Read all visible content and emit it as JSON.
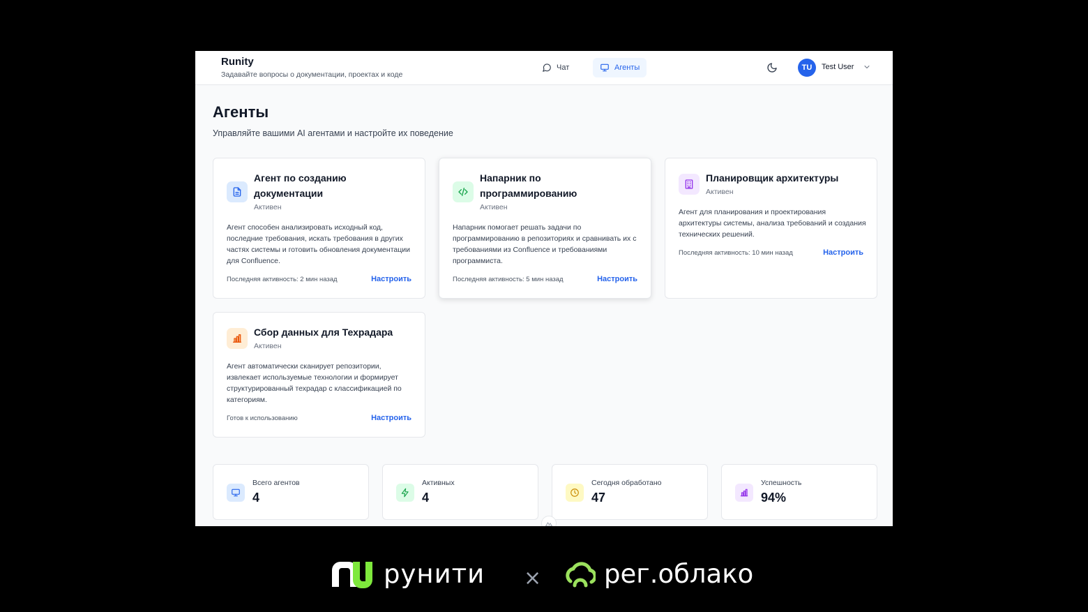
{
  "header": {
    "brand_title": "Runity",
    "brand_subtitle": "Задавайте вопросы о документации, проектах и коде",
    "nav": {
      "chat_label": "Чат",
      "agents_label": "Агенты",
      "active": "agents"
    },
    "user": {
      "initials": "TU",
      "name": "Test User",
      "avatar_color": "#2563eb"
    }
  },
  "page": {
    "title": "Агенты",
    "subtitle": "Управляйте вашими AI агентами и настройте их поведение"
  },
  "agents": [
    {
      "icon": "document-icon",
      "icon_color": "#2563eb",
      "icon_bg": "#dbeafe",
      "title": "Агент по созданию документации",
      "status": "Активен",
      "description": "Агент способен анализировать исходный код, последние требования, искать требования в других частях системы и готовить обновления документации для Confluence.",
      "meta": "Последняя активность: 2 мин назад",
      "action": "Настроить"
    },
    {
      "icon": "code-icon",
      "icon_color": "#16a34a",
      "icon_bg": "#dcfce7",
      "title": "Напарник по программированию",
      "status": "Активен",
      "description": "Напарник помогает решать задачи по программированию в репозиториях и сравнивать их с требованиями из Confluence и требованиями программиста.",
      "meta": "Последняя активность: 5 мин назад",
      "action": "Настроить"
    },
    {
      "icon": "building-icon",
      "icon_color": "#9333ea",
      "icon_bg": "#f3e8ff",
      "title": "Планировщик архитектуры",
      "status": "Активен",
      "description": "Агент для планирования и проектирования архитектуры системы, анализа требований и создания технических решений.",
      "meta": "Последняя активность: 10 мин назад",
      "action": "Настроить"
    },
    {
      "icon": "bar-chart-icon",
      "icon_color": "#ea580c",
      "icon_bg": "#ffedd5",
      "title": "Сбор данных для Техрадара",
      "status": "Активен",
      "description": "Агент автоматически сканирует репозитории, извлекает используемые технологии и формирует структурированный техрадар с классификацией по категориям.",
      "meta": "Готов к использованию",
      "action": "Настроить"
    }
  ],
  "stats": [
    {
      "icon": "monitor-icon",
      "icon_color": "#2563eb",
      "icon_bg": "#dbeafe",
      "label": "Всего агентов",
      "value": "4"
    },
    {
      "icon": "bolt-icon",
      "icon_color": "#16a34a",
      "icon_bg": "#dcfce7",
      "label": "Активных",
      "value": "4"
    },
    {
      "icon": "clock-icon",
      "icon_color": "#ca8a04",
      "icon_bg": "#fef9c3",
      "label": "Сегодня обработано",
      "value": "47"
    },
    {
      "icon": "bar-chart-icon",
      "icon_color": "#9333ea",
      "icon_bg": "#f3e8ff",
      "label": "Успешность",
      "value": "94%"
    }
  ],
  "footer": {
    "logo_left": "рунити",
    "separator": "×",
    "logo_right": "рег.облако",
    "colors": {
      "runity_green": "#7ee83c",
      "reg_green": "#9be15d"
    }
  }
}
